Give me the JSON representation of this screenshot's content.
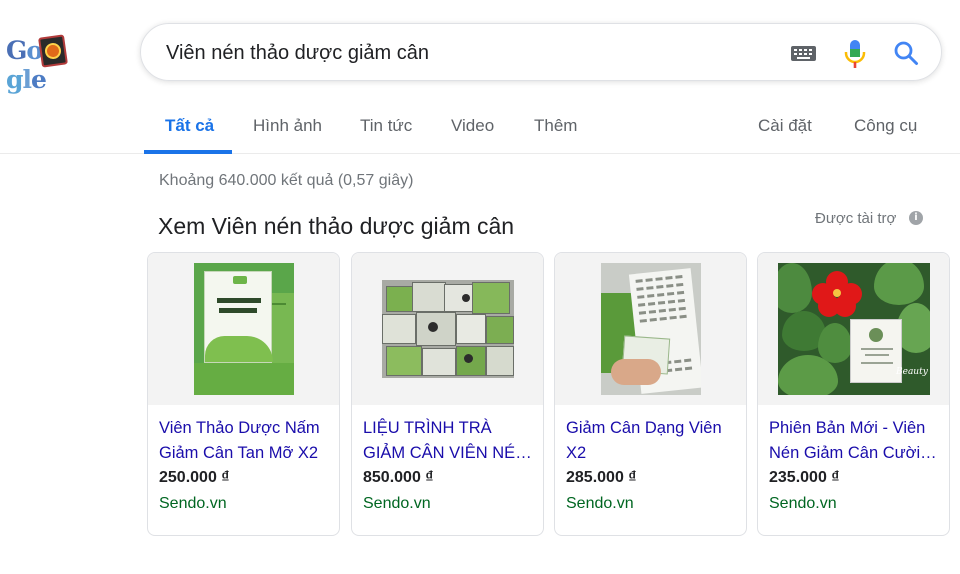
{
  "search": {
    "query": "Viên nén thảo dược giảm cân",
    "keyboard_icon": "keyboard-icon",
    "mic_icon": "mic-icon",
    "search_icon": "search-icon"
  },
  "logo": {
    "text": "Google"
  },
  "tabs": {
    "left": [
      {
        "label": "Tất cả",
        "active": true
      },
      {
        "label": "Hình ảnh"
      },
      {
        "label": "Tin tức"
      },
      {
        "label": "Video"
      },
      {
        "label": "Thêm"
      }
    ],
    "right": [
      {
        "label": "Cài đặt"
      },
      {
        "label": "Công cụ"
      }
    ]
  },
  "result_stats": "Khoảng 640.000 kết quả (0,57 giây)",
  "shopping": {
    "title": "Xem Viên nén thảo dược giảm cân",
    "sponsored": "Được tài trợ",
    "info_symbol": "i",
    "products": [
      {
        "title": "Viên Thảo Dược Nấm Giảm Cân Tan Mỡ X2",
        "price": "250.000 ₫",
        "store": "Sendo.vn"
      },
      {
        "title": "LIỆU TRÌNH TRÀ GIẢM CÂN VIÊN NÉN …",
        "price": "850.000 ₫",
        "store": "Sendo.vn"
      },
      {
        "title": "Giảm Cân Dạng Viên X2",
        "price": "285.000 ₫",
        "store": "Sendo.vn"
      },
      {
        "title": "Phiên Bản Mới - Viên Nén Giảm Cân Cười …",
        "price": "235.000 ₫",
        "store": "Sendo.vn"
      }
    ]
  },
  "colors": {
    "link_blue": "#1a0dab",
    "tab_active": "#1a73e8",
    "store_green": "#006621",
    "muted": "#70757a"
  }
}
